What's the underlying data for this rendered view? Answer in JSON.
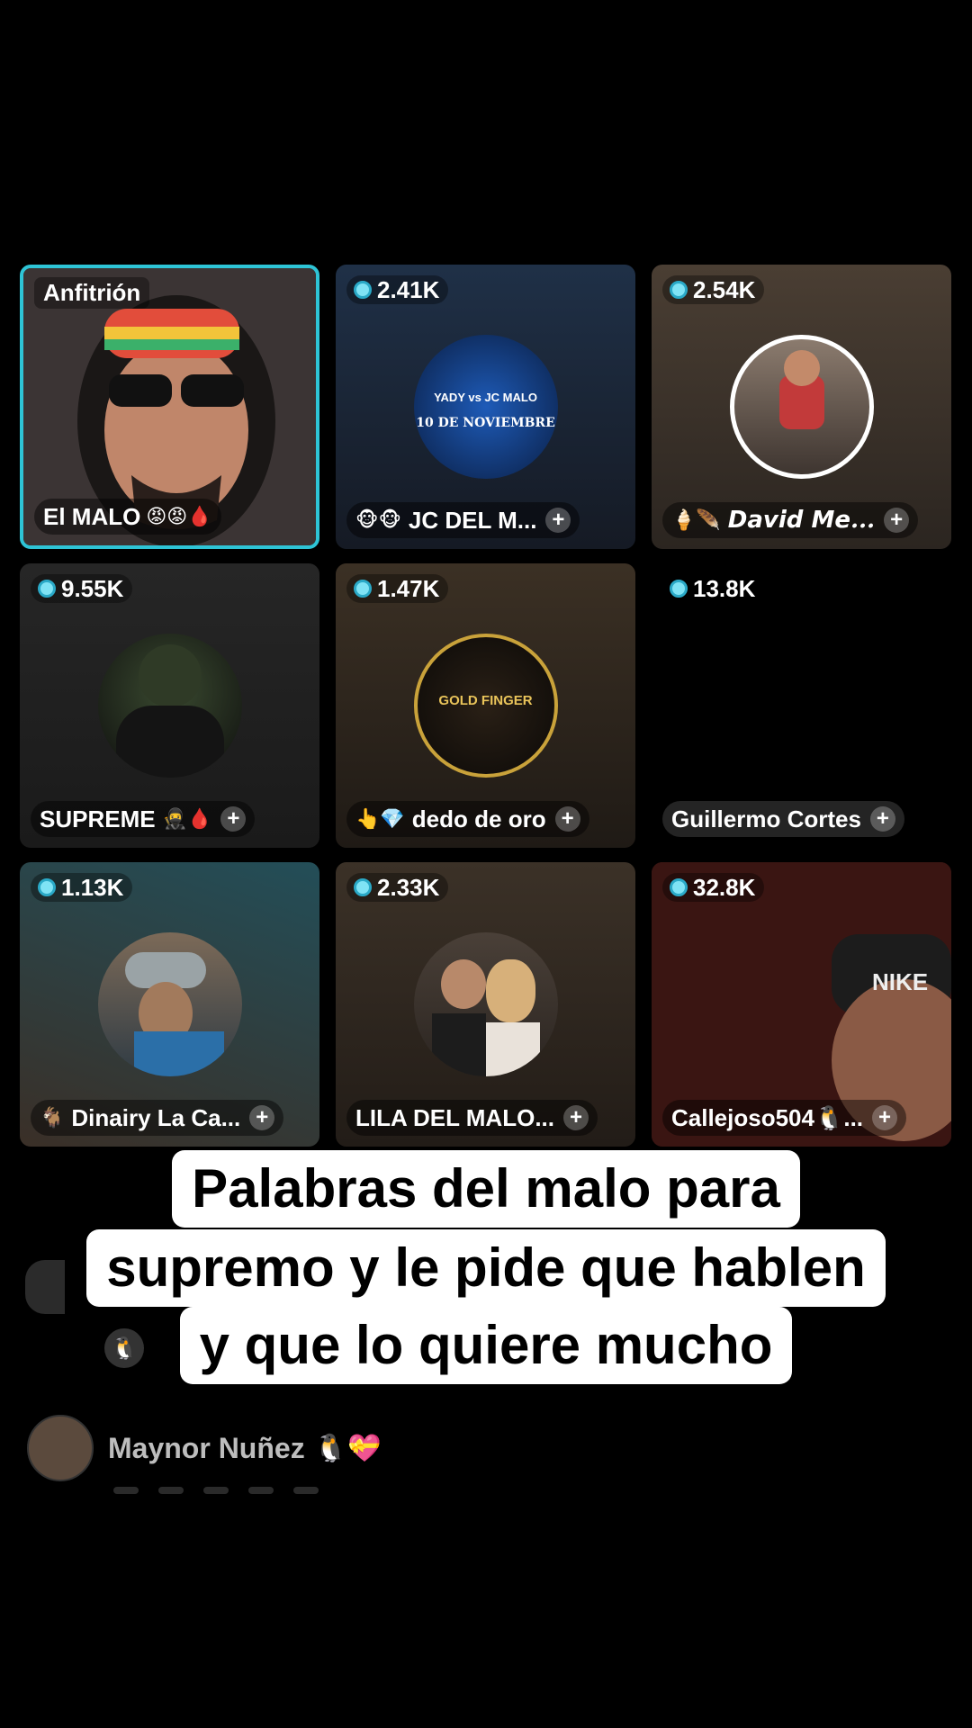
{
  "host": {
    "label": "Anfitrión",
    "name": "El MALO",
    "name_emojis": "😡😡🩸"
  },
  "guests": [
    {
      "coins": "2.41K",
      "name": "JC DEL M...",
      "emojis": "🐵🐵",
      "avatar_text_top": "YADY vs JC MALO",
      "avatar_text_bottom": "10 DE NOVIEMBRE"
    },
    {
      "coins": "2.54K",
      "name": "𝘿𝙖𝙫𝙞𝙙 𝙈𝙚...",
      "emojis": "🍦🪶"
    },
    {
      "coins": "9.55K",
      "name": "SUPREME",
      "emojis_after": "🥷🩸"
    },
    {
      "coins": "1.47K",
      "name": "dedo de oro",
      "emojis": "👆💎",
      "avatar_text": "GOLD FINGER"
    },
    {
      "coins": "13.8K",
      "name": "Guillermo Cortes"
    },
    {
      "coins": "1.13K",
      "name": "Dinairy La Ca...",
      "emojis": "🐐"
    },
    {
      "coins": "2.33K",
      "name": "LILA DEL MALO..."
    },
    {
      "coins": "32.8K",
      "name": "Callejoso504🐧...",
      "cam_text": "NIKE"
    }
  ],
  "caption": [
    "Palabras del malo para",
    "supremo y le pide que hablen",
    "y que lo quiere mucho"
  ],
  "chat": {
    "name": "Maynor Nuñez",
    "badges": "🐧💝"
  },
  "side_emoji": "🐧",
  "colors": {
    "host_border": "#2ec4d6",
    "coin": "#7fe3f5"
  }
}
